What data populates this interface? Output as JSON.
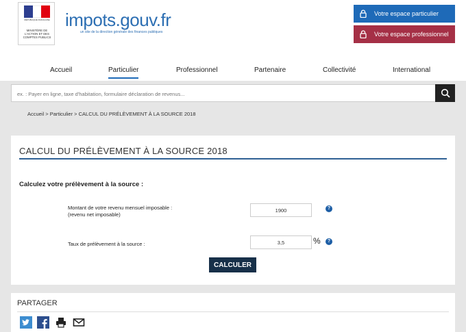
{
  "header": {
    "ministry_logo_small_text": "RÉPUBLIQUE FRANÇAISE",
    "ministry_text": "MINISTÈRE DE L'ACTION ET DES COMPTES PUBLICS",
    "brand": "impots.gouv.fr",
    "brand_subtitle": "un site de la direction générale des finances publiques",
    "btn_particulier": "Votre espace particulier",
    "btn_professionnel": "Votre espace professionnel",
    "colors": {
      "particulier": "#1e6ab8",
      "professionnel": "#a53046"
    }
  },
  "nav": {
    "items": [
      "Accueil",
      "Particulier",
      "Professionnel",
      "Partenaire",
      "Collectivité",
      "International"
    ],
    "active": "Particulier"
  },
  "search": {
    "placeholder": "ex. : Payer en ligne, taxe d'habitation, formulaire déclaration de revenus...",
    "icon": "search-icon"
  },
  "breadcrumb": "Accueil > Particulier > CALCUL DU PRÉLÈVEMENT À LA SOURCE 2018",
  "form": {
    "title": "CALCUL DU PRÉLÈVEMENT À LA SOURCE 2018",
    "subtitle": "Calculez votre prélèvement à la source :",
    "revenu_label_1": "Montant de votre revenu mensuel imposable :",
    "revenu_label_2": "(revenu net imposable)",
    "revenu_value": "1900",
    "taux_label": "Taux de prélèvement à la source :",
    "taux_value": "3,5",
    "percent_sign": "%",
    "help_glyph": "?",
    "calc_button": "CALCULER"
  },
  "share": {
    "title": "PARTAGER",
    "icons": [
      "twitter-icon",
      "facebook-icon",
      "print-icon",
      "email-icon"
    ]
  }
}
